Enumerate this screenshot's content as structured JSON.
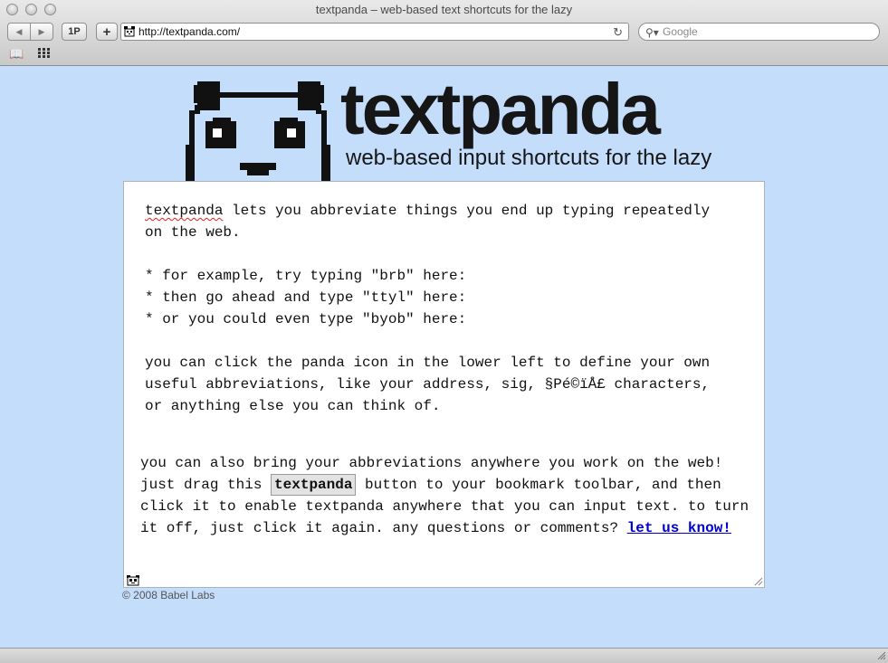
{
  "window": {
    "title": "textpanda – web-based text shortcuts for the lazy"
  },
  "toolbar": {
    "back_icon": "back-arrow-icon",
    "forward_icon": "forward-arrow-icon",
    "onepassword_label": "1P",
    "add_label": "+",
    "url": "http://textpanda.com/",
    "search_placeholder": "Google"
  },
  "bookmarks_bar": {
    "icons": [
      "bookmarks-book-icon",
      "top-sites-grid-icon"
    ]
  },
  "header": {
    "logo_text": "textpanda",
    "tagline": "web-based input shortcuts for the lazy"
  },
  "textarea": {
    "first_word": "textpanda",
    "line1_rest": " lets you abbreviate things you end up typing repeatedly",
    "line2": "on the web.",
    "bullet1": "* for example, try typing \"brb\" here:",
    "bullet2": "* then go ahead and type \"ttyl\" here:",
    "bullet3": "* or you could even type \"byob\" here:",
    "para2_line1": "you can click the panda icon in the lower left to define your own",
    "para2_line2": "useful abbreviations, like your address, sig, §Pé©ïÅ£ characters,",
    "para2_line3": "or anything else you can think of."
  },
  "info": {
    "before_button": "you can also bring your abbreviations anywhere you work on the web! just drag this ",
    "bookmarklet_label": "textpanda",
    "after_button": " button to your bookmark toolbar, and then click it to enable textpanda anywhere that you can input text. to turn it off, just click it again. any questions or comments? ",
    "link_text": "let us know!"
  },
  "footer": {
    "copyright": "© 2008 Babel Labs"
  }
}
